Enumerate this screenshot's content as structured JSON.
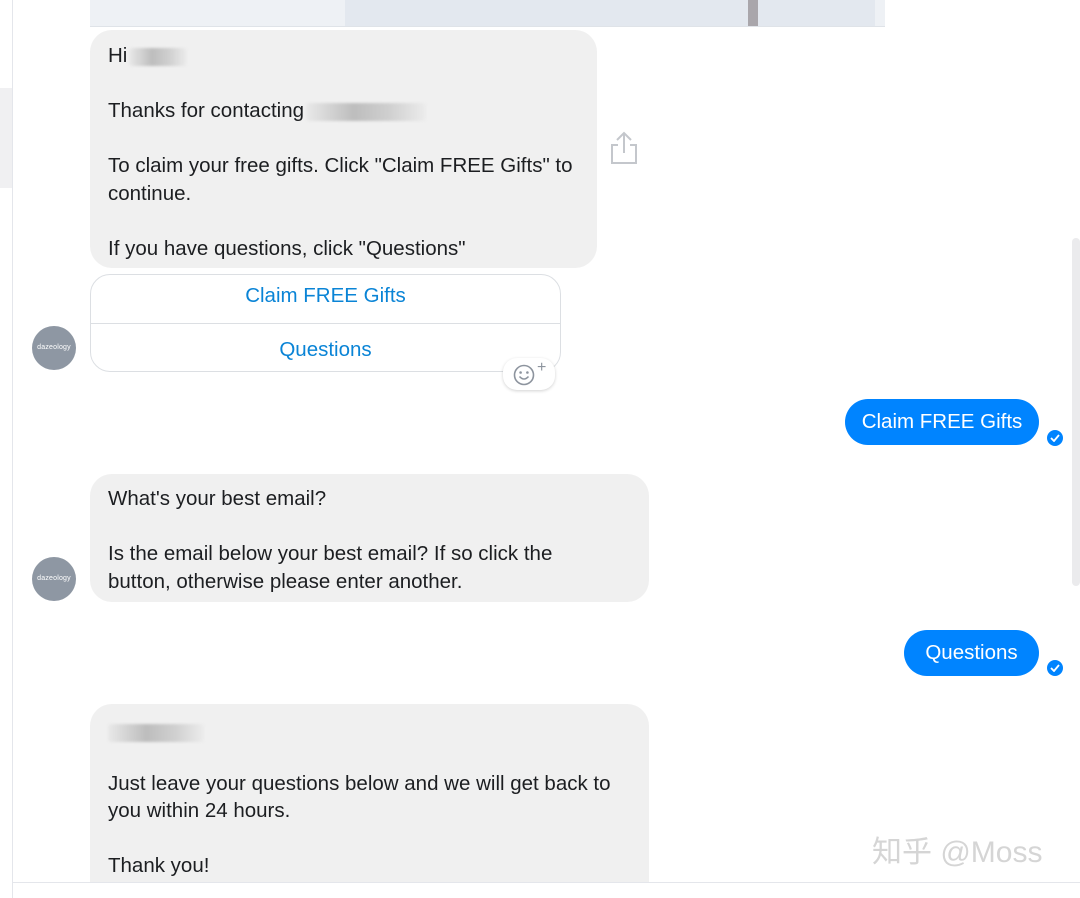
{
  "top_image": {
    "icon": "photo-preview"
  },
  "messages": {
    "bot_1": {
      "greeting_prefix": "Hi",
      "thanks_prefix": "Thanks for contacting",
      "claim_instruction": "To claim your free gifts. Click \"Claim FREE Gifts\" to continue.",
      "questions_instruction": "If you have questions, click \"Questions\""
    },
    "quick_replies": [
      {
        "label": "Claim FREE Gifts"
      },
      {
        "label": "Questions"
      }
    ],
    "user_1": {
      "text": "Claim FREE Gifts",
      "status": "delivered"
    },
    "bot_2": {
      "line1": "What's your best email?",
      "line2": "Is the email below your best email? If so click the button, otherwise please enter another."
    },
    "user_2": {
      "text": "Questions",
      "status": "delivered"
    },
    "bot_3": {
      "line1": "Just leave your questions below and we will get back to you within 24 hours.",
      "line2": "Thank you!"
    }
  },
  "avatar": {
    "label": "dazeology"
  },
  "icons": {
    "share": "share-icon",
    "react": "add-reaction-icon",
    "check": "delivered-check-icon"
  },
  "colors": {
    "accent": "#0084ff",
    "link": "#0a84d6",
    "bubble_gray": "#f0f0f0"
  },
  "watermark": "知乎 @Moss"
}
